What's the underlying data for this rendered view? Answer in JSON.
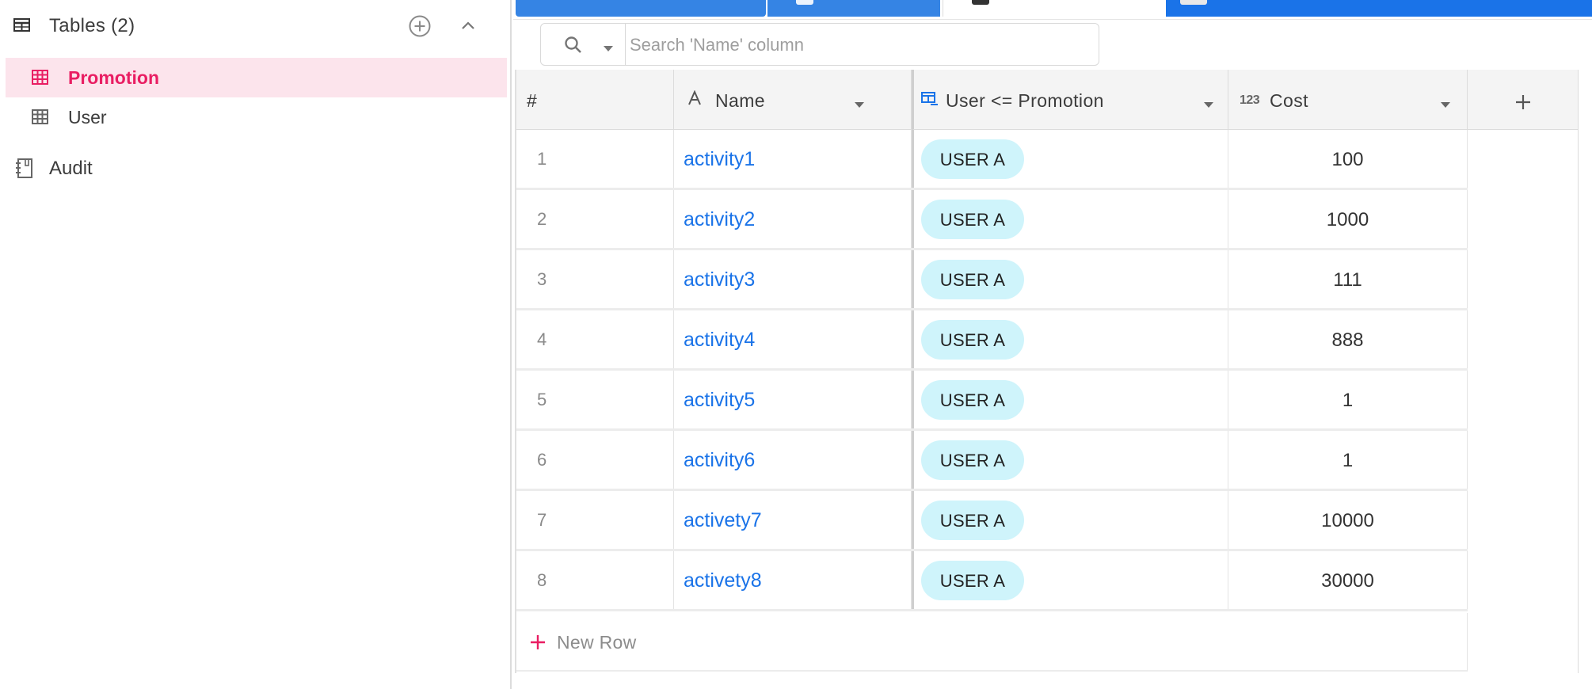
{
  "sidebar": {
    "tables_header": "Tables (2)",
    "tables": [
      {
        "label": "Promotion",
        "active": true
      },
      {
        "label": "User",
        "active": false
      }
    ],
    "audit_label": "Audit"
  },
  "search": {
    "placeholder": "Search 'Name' column"
  },
  "grid": {
    "columns": {
      "row_number": "#",
      "name": "Name",
      "user": "User <= Promotion",
      "cost": "Cost"
    },
    "rows": [
      {
        "num": "1",
        "name": "activity1",
        "user": "USER A",
        "cost": "100"
      },
      {
        "num": "2",
        "name": "activity2",
        "user": "USER A",
        "cost": "1000"
      },
      {
        "num": "3",
        "name": "activity3",
        "user": "USER A",
        "cost": "111"
      },
      {
        "num": "4",
        "name": "activity4",
        "user": "USER A",
        "cost": "888"
      },
      {
        "num": "5",
        "name": "activity5",
        "user": "USER A",
        "cost": "1"
      },
      {
        "num": "6",
        "name": "activity6",
        "user": "USER A",
        "cost": "1"
      },
      {
        "num": "7",
        "name": "activety7",
        "user": "USER A",
        "cost": "10000"
      },
      {
        "num": "8",
        "name": "activety8",
        "user": "USER A",
        "cost": "30000"
      }
    ],
    "new_row_label": "New Row"
  },
  "colors": {
    "accent": "#e91e63",
    "link": "#1a73e8",
    "chip": "#cff4fb",
    "tab_blue": "#3584e4"
  }
}
